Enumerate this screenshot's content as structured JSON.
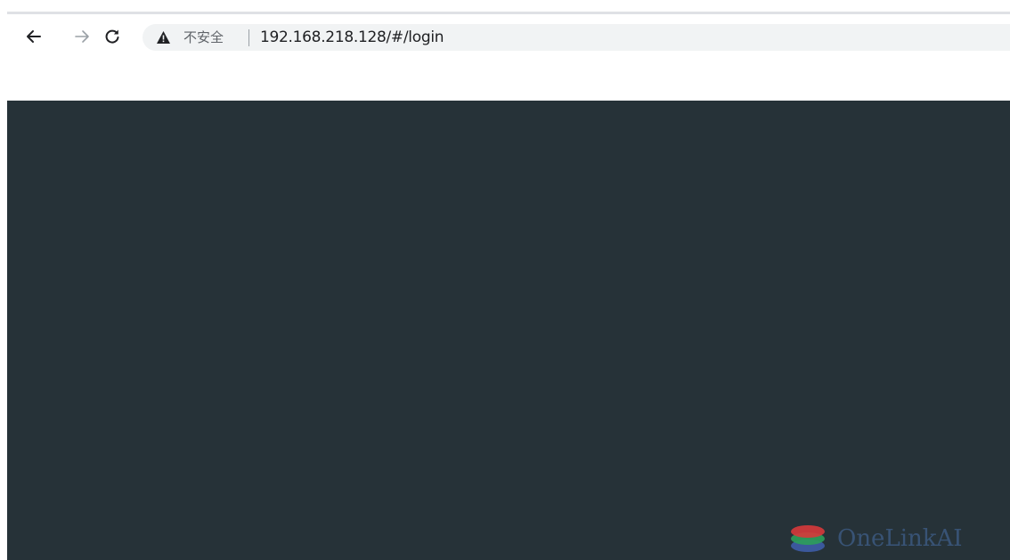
{
  "browser": {
    "back_icon": "arrow-left-icon",
    "forward_icon": "arrow-right-icon",
    "reload_icon": "reload-icon",
    "security_icon": "warning-triangle-icon",
    "security_label": "不安全",
    "url": "192.168.218.128/#/login"
  },
  "page": {
    "background_color": "#263238"
  },
  "watermark": {
    "text": "OneLinkAI"
  }
}
